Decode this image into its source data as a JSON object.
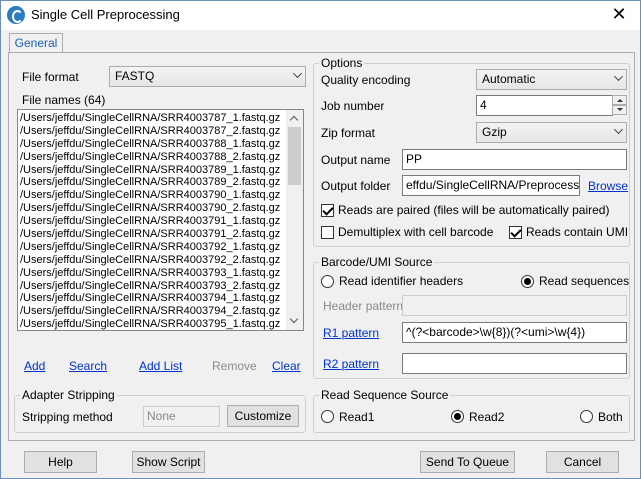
{
  "window": {
    "title": "Single Cell Preprocessing",
    "close_glyph": "✕"
  },
  "tabs": [
    {
      "label": "General"
    }
  ],
  "left": {
    "file_format": {
      "label": "File format",
      "value": "FASTQ"
    },
    "file_names": {
      "label": "File names (64)",
      "items": [
        "/Users/jeffdu/SingleCellRNA/SRR4003787_1.fastq.gz",
        "/Users/jeffdu/SingleCellRNA/SRR4003787_2.fastq.gz",
        "/Users/jeffdu/SingleCellRNA/SRR4003788_1.fastq.gz",
        "/Users/jeffdu/SingleCellRNA/SRR4003788_2.fastq.gz",
        "/Users/jeffdu/SingleCellRNA/SRR4003789_1.fastq.gz",
        "/Users/jeffdu/SingleCellRNA/SRR4003789_2.fastq.gz",
        "/Users/jeffdu/SingleCellRNA/SRR4003790_1.fastq.gz",
        "/Users/jeffdu/SingleCellRNA/SRR4003790_2.fastq.gz",
        "/Users/jeffdu/SingleCellRNA/SRR4003791_1.fastq.gz",
        "/Users/jeffdu/SingleCellRNA/SRR4003791_2.fastq.gz",
        "/Users/jeffdu/SingleCellRNA/SRR4003792_1.fastq.gz",
        "/Users/jeffdu/SingleCellRNA/SRR4003792_2.fastq.gz",
        "/Users/jeffdu/SingleCellRNA/SRR4003793_1.fastq.gz",
        "/Users/jeffdu/SingleCellRNA/SRR4003793_2.fastq.gz",
        "/Users/jeffdu/SingleCellRNA/SRR4003794_1.fastq.gz",
        "/Users/jeffdu/SingleCellRNA/SRR4003794_2.fastq.gz",
        "/Users/jeffdu/SingleCellRNA/SRR4003795_1.fastq.gz"
      ]
    },
    "actions": {
      "add": "Add",
      "search": "Search",
      "add_list": "Add List",
      "remove": "Remove",
      "clear": "Clear"
    },
    "adapter": {
      "title": "Adapter Stripping",
      "method_label": "Stripping method",
      "method_value": "None",
      "customize": "Customize"
    }
  },
  "options": {
    "title": "Options",
    "quality_encoding": {
      "label": "Quality encoding",
      "value": "Automatic"
    },
    "job_number": {
      "label": "Job number",
      "value": "4"
    },
    "zip_format": {
      "label": "Zip format",
      "value": "Gzip"
    },
    "output_name": {
      "label": "Output name",
      "value": "PP"
    },
    "output_folder": {
      "label": "Output folder",
      "value": "effdu/SingleCellRNA/Preprocessing",
      "browse": "Browse"
    },
    "reads_paired": {
      "label": "Reads are paired (files will be automatically paired)",
      "checked": true
    },
    "demultiplex": {
      "label": "Demultiplex with cell barcode",
      "checked": false
    },
    "contain_umi": {
      "label": "Reads contain UMI",
      "checked": true
    }
  },
  "barcode": {
    "title": "Barcode/UMI Source",
    "read_headers": {
      "label": "Read identifier headers",
      "selected": false
    },
    "read_sequences": {
      "label": "Read sequences",
      "selected": true
    },
    "header_pattern": {
      "label": "Header pattern",
      "value": ""
    },
    "r1_pattern": {
      "label": "R1 pattern",
      "value": "^(?<barcode>\\w{8})(?<umi>\\w{4})"
    },
    "r2_pattern": {
      "label": "R2 pattern",
      "value": ""
    }
  },
  "read_source": {
    "title": "Read Sequence Source",
    "read1": {
      "label": "Read1",
      "selected": false
    },
    "read2": {
      "label": "Read2",
      "selected": true
    },
    "both": {
      "label": "Both",
      "selected": false
    }
  },
  "footer": {
    "help": "Help",
    "show_script": "Show Script",
    "send_to_queue": "Send To Queue",
    "cancel": "Cancel"
  }
}
